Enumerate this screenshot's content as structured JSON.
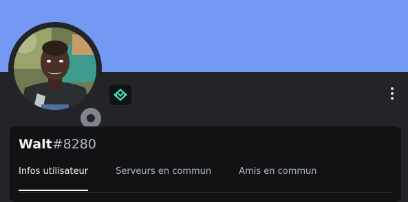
{
  "profile": {
    "username": "Walt",
    "discriminator": "#8280",
    "banner_color": "#7499f2",
    "status": "offline",
    "badge_icon": "hypesquad-balance-icon"
  },
  "tabs": [
    {
      "label": "Infos utilisateur",
      "active": true
    },
    {
      "label": "Serveurs en commun",
      "active": false
    },
    {
      "label": "Amis en commun",
      "active": false
    }
  ],
  "icons": {
    "more": "more-vertical-icon"
  }
}
